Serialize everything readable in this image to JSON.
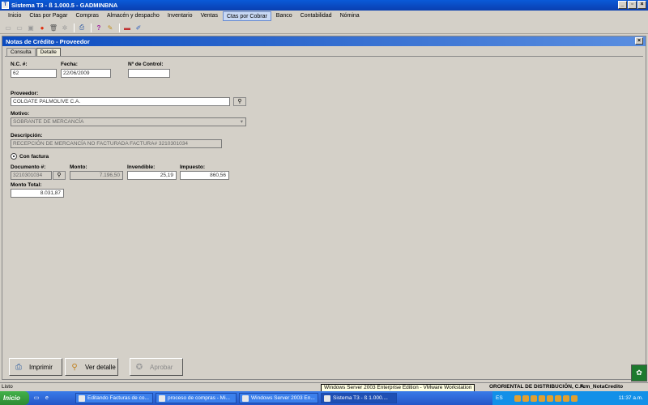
{
  "window": {
    "title": "Sistema T3 - ß 1.000.5 - GADMINBNA"
  },
  "menu": [
    "Inicio",
    "Ctas por Pagar",
    "Compras",
    "Almacén y despacho",
    "Inventario",
    "Ventas",
    "Ctas por Cobrar",
    "Banco",
    "Contabilidad",
    "Nómina"
  ],
  "menu_active_index": 6,
  "child": {
    "title": "Notas de Crédito - Proveedor",
    "tabs": [
      "Consulta",
      "Detalle"
    ],
    "form": {
      "nc_label": "N.C. #:",
      "nc_value": "62",
      "fecha_label": "Fecha:",
      "fecha_value": "22/06/2009",
      "control_label": "Nº de Control:",
      "control_value": "",
      "proveedor_label": "Proveedor:",
      "proveedor_value": "COLGATE PALMOLIVE C.A.",
      "motivo_label": "Motivo:",
      "motivo_value": "SOBRANTE DE MERCANCÍA",
      "descripcion_label": "Descripción:",
      "descripcion_value": "RECEPCIÓN DE MERCANCÍA NO FACTURADA FACTURA# 3210301034",
      "con_factura_label": "Con factura",
      "documento_label": "Documento #:",
      "documento_value": "3210301034",
      "monto_label": "Monto:",
      "monto_value": "7.196,50",
      "invendible_label": "Invendible:",
      "invendible_value": "25,19",
      "impuesto_label": "Impuesto:",
      "impuesto_value": "860,56",
      "monto_total_label": "Monto Total:",
      "monto_total_value": "8.031,87"
    },
    "buttons": {
      "imprimir": "Imprimir",
      "ver_detalle": "Ver detalle",
      "aprobar": "Aprobar"
    }
  },
  "status": {
    "left": "Listo",
    "tooltip": "Windows Server 2003 Enterprise Edition - VMware Workstation",
    "company": "ORORIENTAL DE DISTRIBUCIÓN, C.A.",
    "form": "Frm_NotaCredito"
  },
  "taskbar": {
    "start": "Inicio",
    "tasks": [
      "Editando Facturas de co...",
      "proceso de compras - Mi...",
      "Windows Server 2003 En...",
      "Sistema T3 - ß 1.000...."
    ],
    "active_task_index": 3,
    "lang": "ES",
    "clock": "11:37 a.m."
  }
}
